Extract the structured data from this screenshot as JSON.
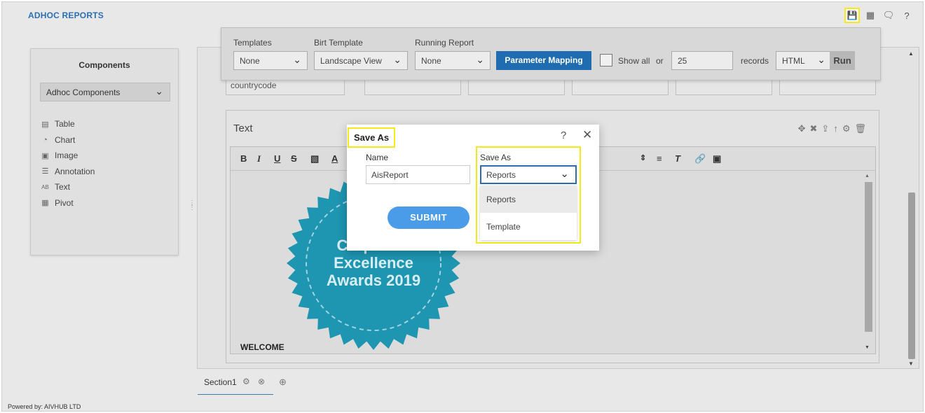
{
  "app": {
    "title": "ADHOC REPORTS",
    "footer": "Powered by: AIVHUB LTD"
  },
  "top_icons": [
    "save-icon",
    "table-icon",
    "comment-icon",
    "help-icon"
  ],
  "toolbar": {
    "templates_label": "Templates",
    "templates_value": "None",
    "birt_label": "Birt Template",
    "birt_value": "Landscape View",
    "running_label": "Running Report",
    "running_value": "None",
    "parameter_mapping": "Parameter Mapping",
    "show_all": "Show all",
    "or": "or",
    "records_value": "25",
    "records": "records",
    "format_value": "HTML",
    "run": "Run"
  },
  "components": {
    "title": "Components",
    "select_value": "Adhoc Components",
    "items": [
      {
        "label": "Table",
        "icon": "table-icon"
      },
      {
        "label": "Chart",
        "icon": "chart-icon"
      },
      {
        "label": "Image",
        "icon": "image-icon"
      },
      {
        "label": "Annotation",
        "icon": "annotation-icon"
      },
      {
        "label": "Text",
        "icon": "text-icon"
      },
      {
        "label": "Pivot",
        "icon": "pivot-icon"
      }
    ]
  },
  "canvas": {
    "partial_cell": "countrycode",
    "text_panel_title": "Text",
    "welcome": "WELCOME",
    "badge_line1": "Corporate",
    "badge_line2": "Excellence",
    "badge_line3": "Awards 2019"
  },
  "section": {
    "label": "Section1"
  },
  "dialog": {
    "title": "Save As",
    "name_label": "Name",
    "name_value": "AisReport",
    "submit": "SUBMIT",
    "saveas_label": "Save As",
    "saveas_value": "Reports",
    "options": [
      "Reports",
      "Template"
    ]
  },
  "colors": {
    "highlight": "#f2ea1c",
    "primary": "#1f6db0",
    "submit": "#4a9ce8",
    "badge": "#1e95b1"
  }
}
